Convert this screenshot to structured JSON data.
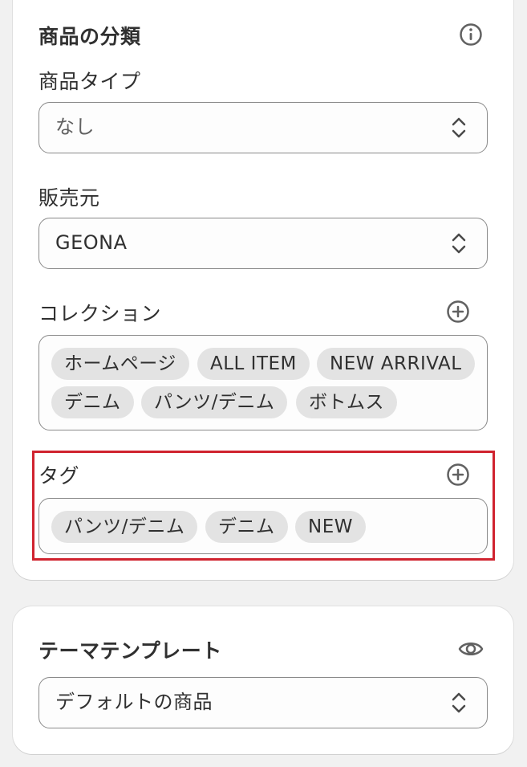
{
  "product_org": {
    "title": "商品の分類",
    "product_type": {
      "label": "商品タイプ",
      "value": "なし"
    },
    "vendor": {
      "label": "販売元",
      "value": "GEONA"
    },
    "collections": {
      "label": "コレクション",
      "items": [
        "ホームページ",
        "ALL ITEM",
        "NEW ARRIVAL",
        "デニム",
        "パンツ/デニム",
        "ボトムス"
      ]
    },
    "tags": {
      "label": "タグ",
      "items": [
        "パンツ/デニム",
        "デニム",
        "NEW"
      ]
    }
  },
  "theme_template": {
    "title": "テーマテンプレート",
    "value": "デフォルトの商品"
  },
  "icons": {
    "info": "info-icon",
    "add": "plus-circle-icon",
    "preview": "eye-icon",
    "select": "chevron-up-down-icon"
  },
  "colors": {
    "highlight": "#d0232f",
    "chip_bg": "#e3e3e3",
    "border": "#8a8a8a"
  }
}
